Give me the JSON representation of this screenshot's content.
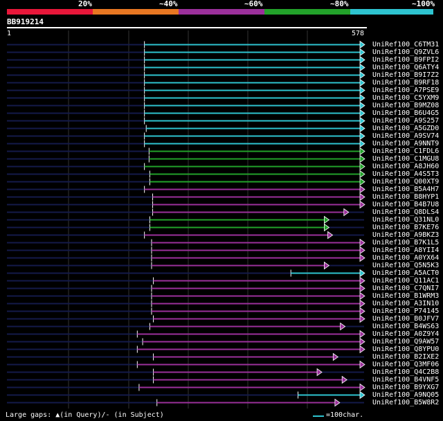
{
  "legend": [
    {
      "label": "20%",
      "color": "#e8173a"
    },
    {
      "label": "~40%",
      "color": "#e87722"
    },
    {
      "label": "~60%",
      "color": "#9b309b"
    },
    {
      "label": "~80%",
      "color": "#22a22a"
    },
    {
      "label": "~100%",
      "color": "#2ec4d0"
    }
  ],
  "query": {
    "name": "BB919214",
    "start": "1",
    "end": "578"
  },
  "colors": {
    "cyan": "#2ec4d0",
    "green": "#22a22a",
    "purple": "#9b309b",
    "navy": "#141a4a",
    "grid": "#333333"
  },
  "hits": [
    {
      "label": "UniRef100_C6TM31",
      "color": "cyan",
      "start": 0.385,
      "end": 1.0
    },
    {
      "label": "UniRef100_Q9ZVL6",
      "color": "cyan",
      "start": 0.385,
      "end": 1.0
    },
    {
      "label": "UniRef100_B9FPI2",
      "color": "cyan",
      "start": 0.385,
      "end": 1.0
    },
    {
      "label": "UniRef100_Q6ATY4",
      "color": "cyan",
      "start": 0.385,
      "end": 1.0
    },
    {
      "label": "UniRef100_B9I7Z2",
      "color": "cyan",
      "start": 0.385,
      "end": 1.0
    },
    {
      "label": "UniRef100_B9RF18",
      "color": "cyan",
      "start": 0.385,
      "end": 1.0
    },
    {
      "label": "UniRef100_A7PSE9",
      "color": "cyan",
      "start": 0.385,
      "end": 1.0
    },
    {
      "label": "UniRef100_C5YXM9",
      "color": "cyan",
      "start": 0.385,
      "end": 1.0
    },
    {
      "label": "UniRef100_B9MZ08",
      "color": "cyan",
      "start": 0.385,
      "end": 1.0
    },
    {
      "label": "UniRef100_B6U4G5",
      "color": "cyan",
      "start": 0.385,
      "end": 1.0
    },
    {
      "label": "UniRef100_A9S257",
      "color": "cyan",
      "start": 0.385,
      "end": 1.0
    },
    {
      "label": "UniRef100_A5GZD0",
      "color": "cyan",
      "start": 0.39,
      "end": 1.0
    },
    {
      "label": "UniRef100_A9SV74",
      "color": "cyan",
      "start": 0.385,
      "end": 1.0
    },
    {
      "label": "UniRef100_A9NNT9",
      "color": "cyan",
      "start": 0.385,
      "end": 1.0
    },
    {
      "label": "UniRef100_C1FDL6",
      "color": "green",
      "start": 0.398,
      "end": 1.0
    },
    {
      "label": "UniRef100_C1MGU8",
      "color": "green",
      "start": 0.398,
      "end": 1.0
    },
    {
      "label": "UniRef100_A8JH60",
      "color": "green",
      "start": 0.385,
      "end": 1.0
    },
    {
      "label": "UniRef100_A4S5T3",
      "color": "green",
      "start": 0.4,
      "end": 1.0
    },
    {
      "label": "UniRef100_Q00XT9",
      "color": "green",
      "start": 0.4,
      "end": 1.0
    },
    {
      "label": "UniRef100_B5A4H7",
      "color": "purple",
      "start": 0.385,
      "end": 1.0
    },
    {
      "label": "UniRef100_B8HYP1",
      "color": "purple",
      "start": 0.408,
      "end": 1.0
    },
    {
      "label": "UniRef100_B4B7U8",
      "color": "purple",
      "start": 0.408,
      "end": 1.0
    },
    {
      "label": "UniRef100_Q8DLS4",
      "color": "purple",
      "start": 0.408,
      "end": 0.955
    },
    {
      "label": "UniRef100_Q31NL0",
      "color": "green",
      "start": 0.4,
      "end": 0.9
    },
    {
      "label": "UniRef100_B7KE76",
      "color": "green",
      "start": 0.4,
      "end": 0.9
    },
    {
      "label": "UniRef100_A9BKZ3",
      "color": "purple",
      "start": 0.385,
      "end": 0.91
    },
    {
      "label": "UniRef100_B7K1L5",
      "color": "purple",
      "start": 0.405,
      "end": 1.0
    },
    {
      "label": "UniRef100_A8YII4",
      "color": "purple",
      "start": 0.405,
      "end": 1.0
    },
    {
      "label": "UniRef100_A0YX64",
      "color": "purple",
      "start": 0.405,
      "end": 1.0
    },
    {
      "label": "UniRef100_Q5N5K3",
      "color": "purple",
      "start": 0.405,
      "end": 0.9
    },
    {
      "label": "UniRef100_A5ACT0",
      "color": "cyan",
      "start": 0.795,
      "end": 1.0
    },
    {
      "label": "UniRef100_Q11AC1",
      "color": "purple",
      "start": 0.41,
      "end": 1.0
    },
    {
      "label": "UniRef100_C7QNI7",
      "color": "purple",
      "start": 0.405,
      "end": 1.0
    },
    {
      "label": "UniRef100_B1WRM3",
      "color": "purple",
      "start": 0.405,
      "end": 1.0
    },
    {
      "label": "UniRef100_A3IN10",
      "color": "purple",
      "start": 0.405,
      "end": 1.0
    },
    {
      "label": "UniRef100_P74145",
      "color": "purple",
      "start": 0.405,
      "end": 1.0
    },
    {
      "label": "UniRef100_B0JFV7",
      "color": "purple",
      "start": 0.41,
      "end": 1.0
    },
    {
      "label": "UniRef100_B4WS63",
      "color": "purple",
      "start": 0.4,
      "end": 0.945
    },
    {
      "label": "UniRef100_A0Z9Y4",
      "color": "purple",
      "start": 0.365,
      "end": 1.0
    },
    {
      "label": "UniRef100_Q9AW57",
      "color": "purple",
      "start": 0.38,
      "end": 1.0
    },
    {
      "label": "UniRef100_Q8YPU0",
      "color": "purple",
      "start": 0.365,
      "end": 1.0
    },
    {
      "label": "UniRef100_B2IXE2",
      "color": "purple",
      "start": 0.41,
      "end": 0.925
    },
    {
      "label": "UniRef100_Q3MF06",
      "color": "purple",
      "start": 0.365,
      "end": 1.0
    },
    {
      "label": "UniRef100_Q4C2B8",
      "color": "purple",
      "start": 0.41,
      "end": 0.88
    },
    {
      "label": "UniRef100_B4VNF5",
      "color": "purple",
      "start": 0.41,
      "end": 0.95
    },
    {
      "label": "UniRef100_B9YXG7",
      "color": "purple",
      "start": 0.37,
      "end": 1.0
    },
    {
      "label": "UniRef100_A9NQ05",
      "color": "cyan",
      "start": 0.815,
      "end": 1.0
    },
    {
      "label": "UniRef100_B5W8R2",
      "color": "purple",
      "start": 0.42,
      "end": 0.93
    }
  ],
  "footer": {
    "left": "Large gaps: ▲(in Query)/- (in Subject)",
    "right": "=100char."
  }
}
